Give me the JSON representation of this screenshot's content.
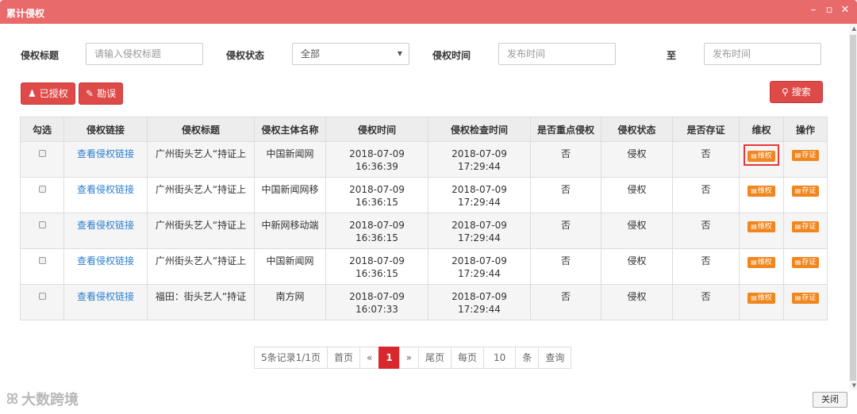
{
  "window": {
    "title": "累计侵权",
    "close_label": "关闭"
  },
  "filters": {
    "title_label": "侵权标题",
    "title_placeholder": "请输入侵权标题",
    "status_label": "侵权状态",
    "status_value": "全部",
    "time_label": "侵权时间",
    "time_start_placeholder": "发布时间",
    "to_label": "至",
    "time_end_placeholder": "发布时间"
  },
  "toolbar": {
    "authorized_label": "已授权",
    "error_label": "勘误",
    "search_label": "搜索"
  },
  "table": {
    "headers": [
      "勾选",
      "侵权链接",
      "侵权标题",
      "侵权主体名称",
      "侵权时间",
      "侵权检查时间",
      "是否重点侵权",
      "侵权状态",
      "是否存证",
      "维权",
      "操作"
    ],
    "rows": [
      {
        "link": "查看侵权链接",
        "title": "广州街头艺人“持证上",
        "subject": "中国新闻网",
        "time_date": "2018-07-09",
        "time_clock": "16:36:39",
        "check_date": "2018-07-09",
        "check_clock": "17:29:44",
        "key": "否",
        "status": "侵权",
        "evidence": "否",
        "rights_btn": "维权",
        "op_btn": "存证"
      },
      {
        "link": "查看侵权链接",
        "title": "广州街头艺人“持证上",
        "subject": "中国新闻网移",
        "time_date": "2018-07-09",
        "time_clock": "16:36:15",
        "check_date": "2018-07-09",
        "check_clock": "17:29:44",
        "key": "否",
        "status": "侵权",
        "evidence": "否",
        "rights_btn": "维权",
        "op_btn": "存证"
      },
      {
        "link": "查看侵权链接",
        "title": "广州街头艺人“持证上",
        "subject": "中新网移动端",
        "time_date": "2018-07-09",
        "time_clock": "16:36:15",
        "check_date": "2018-07-09",
        "check_clock": "17:29:44",
        "key": "否",
        "status": "侵权",
        "evidence": "否",
        "rights_btn": "维权",
        "op_btn": "存证"
      },
      {
        "link": "查看侵权链接",
        "title": "广州街头艺人“持证上",
        "subject": "中国新闻网",
        "time_date": "2018-07-09",
        "time_clock": "16:36:15",
        "check_date": "2018-07-09",
        "check_clock": "17:29:44",
        "key": "否",
        "status": "侵权",
        "evidence": "否",
        "rights_btn": "维权",
        "op_btn": "存证"
      },
      {
        "link": "查看侵权链接",
        "title": "福田：街头艺人“持证",
        "subject": "南方网",
        "time_date": "2018-07-09",
        "time_clock": "16:07:33",
        "check_date": "2018-07-09",
        "check_clock": "17:29:44",
        "key": "否",
        "status": "侵权",
        "evidence": "否",
        "rights_btn": "维权",
        "op_btn": "存证"
      }
    ]
  },
  "pager": {
    "summary": "5条记录1/1页",
    "first": "首页",
    "prev": "«",
    "current": "1",
    "next": "»",
    "last": "尾页",
    "per_page_label": "每页",
    "per_page_value": "10",
    "unit": "条",
    "query": "查询"
  },
  "branding": {
    "logo_text": "大数跨境"
  },
  "colors": {
    "titlebar": "#e96a6a",
    "primary_red": "#de4a48",
    "action_orange": "#f0861e",
    "link_blue": "#2b7fd0",
    "highlight": "#e8363a"
  }
}
